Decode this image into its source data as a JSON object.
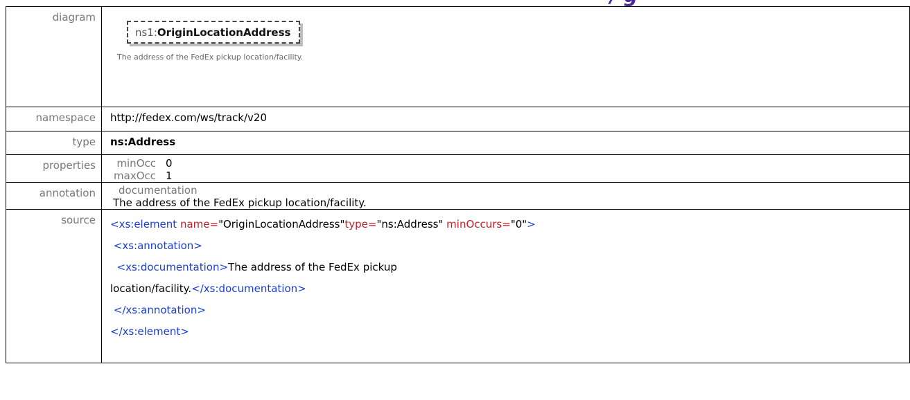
{
  "rows": {
    "diagram": {
      "label": "diagram",
      "node_prefix": "ns1:",
      "node_name": "OriginLocationAddress",
      "node_doc": "The address of the FedEx pickup location/facility."
    },
    "namespace": {
      "label": "namespace",
      "value": "http://fedex.com/ws/track/v20"
    },
    "type": {
      "label": "type",
      "value": "ns:Address"
    },
    "properties": {
      "label": "properties",
      "items": [
        {
          "key": "minOcc",
          "value": "0"
        },
        {
          "key": "maxOcc",
          "value": "1"
        }
      ]
    },
    "annotation": {
      "label": "annotation",
      "sub_label": "documentation",
      "text": "The address of the FedEx pickup location/facility."
    },
    "source": {
      "label": "source",
      "line1": {
        "open": "<xs:element",
        "attr1": " name=",
        "val1": "\"OriginLocationAddress\"",
        "attr2": "type=",
        "val2": "\"ns:Address\"",
        "attr3": " minOccurs=",
        "val3": "\"0\"",
        "close": ">"
      },
      "line2": "<xs:annotation>",
      "line3": {
        "open": "<xs:documentation>",
        "text": "The address of the FedEx pickup"
      },
      "line4": {
        "text": "location/facility.",
        "close": "</xs:documentation>"
      },
      "line5": "</xs:annotation>",
      "line6": "</xs:element>"
    }
  },
  "colors": {
    "tag": "#1a3fd8",
    "attr": "#c0202a",
    "label": "#777777"
  }
}
